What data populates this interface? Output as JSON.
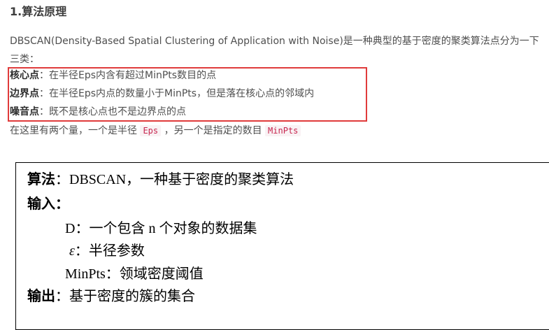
{
  "heading": "1.算法原理",
  "intro": {
    "text": "DBSCAN(Density-Based Spatial Clustering of Application with Noise)是一种典型的基于密度的聚类算法点分为一下三类："
  },
  "definitions": [
    {
      "term": "核心点",
      "desc": "：在半径Eps内含有超过MinPts数目的点"
    },
    {
      "term": "边界点",
      "desc": "：在半径Eps内点的数量小于MinPts，但是落在核心点的邻域内"
    },
    {
      "term": "噪音点",
      "desc": "：既不是核心点也不是边界点的点"
    }
  ],
  "note": {
    "prefix": "在这里有两个量，一个是半径",
    "code1": "Eps",
    "middle": "，另一个是指定的数目",
    "code2": "MinPts"
  },
  "algorithm": {
    "title_label": "算法",
    "title_text": "：DBSCAN，一种基于密度的聚类算法",
    "input_label": "输入：",
    "input_items": [
      "D：一个包含 n 个对象的数据集",
      "：半径参数",
      "MinPts：领域密度阈值"
    ],
    "epsilon_symbol": "ε",
    "output_label": "输出",
    "output_text": "：基于密度的簇的集合"
  }
}
